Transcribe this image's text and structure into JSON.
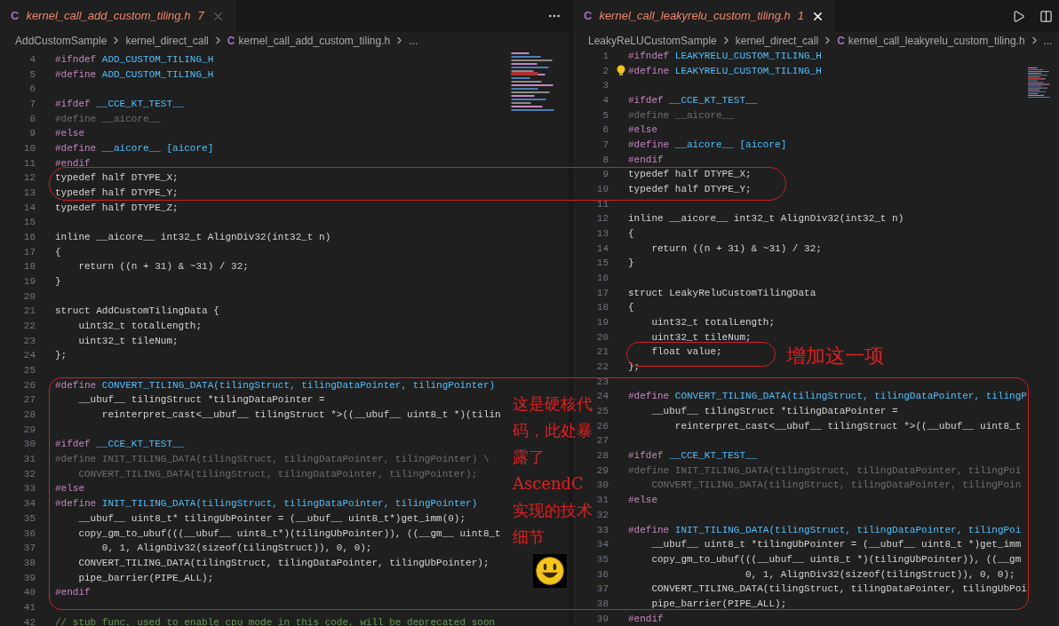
{
  "editors": [
    {
      "tab": {
        "icon": "C",
        "title": "kernel_call_add_custom_tiling.h",
        "problems": "7",
        "focused": false
      },
      "breadcrumbs": [
        {
          "text": "AddCustomSample"
        },
        {
          "text": "kernel_direct_call"
        },
        {
          "text": "kernel_call_add_custom_tiling.h",
          "icon": "C"
        },
        {
          "text": "..."
        }
      ],
      "lines": [
        {
          "n": "4",
          "kind": "directive",
          "text": "#ifndef ADD_CUSTOM_TILING_H"
        },
        {
          "n": "5",
          "kind": "directive",
          "text": "#define ADD_CUSTOM_TILING_H"
        },
        {
          "n": "6",
          "kind": "blank"
        },
        {
          "n": "7",
          "kind": "directive",
          "text": "#ifdef __CCE_KT_TEST__"
        },
        {
          "n": "8",
          "kind": "inactive",
          "text": "#define __aicore__"
        },
        {
          "n": "9",
          "kind": "directive",
          "text": "#else"
        },
        {
          "n": "10",
          "kind": "directive",
          "text": "#define __aicore__ [aicore]"
        },
        {
          "n": "11",
          "kind": "directive",
          "text": "#endif"
        },
        {
          "n": "12",
          "kind": "code",
          "text": "typedef half DTYPE_X;"
        },
        {
          "n": "13",
          "kind": "code",
          "text": "typedef half DTYPE_Y;"
        },
        {
          "n": "14",
          "kind": "code",
          "text": "typedef half DTYPE_Z;"
        },
        {
          "n": "15",
          "kind": "blank"
        },
        {
          "n": "16",
          "kind": "code",
          "text": "inline __aicore__ int32_t AlignDiv32(int32_t n)"
        },
        {
          "n": "17",
          "kind": "code",
          "text": "{"
        },
        {
          "n": "18",
          "kind": "code",
          "text": "    return ((n + 31) & ~31) / 32;"
        },
        {
          "n": "19",
          "kind": "code",
          "text": "}"
        },
        {
          "n": "20",
          "kind": "blank"
        },
        {
          "n": "21",
          "kind": "code",
          "text": "struct AddCustomTilingData {"
        },
        {
          "n": "22",
          "kind": "code",
          "text": "    uint32_t totalLength;"
        },
        {
          "n": "23",
          "kind": "code",
          "text": "    uint32_t tileNum;"
        },
        {
          "n": "24",
          "kind": "code",
          "text": "};"
        },
        {
          "n": "25",
          "kind": "blank"
        },
        {
          "n": "26",
          "kind": "directive",
          "text": "#define CONVERT_TILING_DATA(tilingStruct, tilingDataPointer, tilingPointer)"
        },
        {
          "n": "27",
          "kind": "code",
          "text": "    __ubuf__ tilingStruct *tilingDataPointer ="
        },
        {
          "n": "28",
          "kind": "code",
          "text": "        reinterpret_cast<__ubuf__ tilingStruct *>((__ubuf__ uint8_t *)(tilin"
        },
        {
          "n": "29",
          "kind": "blank"
        },
        {
          "n": "30",
          "kind": "directive",
          "text": "#ifdef __CCE_KT_TEST__"
        },
        {
          "n": "31",
          "kind": "inactive",
          "text": "#define INIT_TILING_DATA(tilingStruct, tilingDataPointer, tilingPointer) \\"
        },
        {
          "n": "32",
          "kind": "inactive",
          "text": "    CONVERT_TILING_DATA(tilingStruct, tilingDataPointer, tilingPointer);"
        },
        {
          "n": "33",
          "kind": "directive",
          "text": "#else"
        },
        {
          "n": "34",
          "kind": "directive",
          "text": "#define INIT_TILING_DATA(tilingStruct, tilingDataPointer, tilingPointer)"
        },
        {
          "n": "35",
          "kind": "code",
          "text": "    __ubuf__ uint8_t* tilingUbPointer = (__ubuf__ uint8_t*)get_imm(0);"
        },
        {
          "n": "36",
          "kind": "code",
          "text": "    copy_gm_to_ubuf(((__ubuf__ uint8_t*)(tilingUbPointer)), ((__gm__ uint8_t"
        },
        {
          "n": "37",
          "kind": "code",
          "text": "        0, 1, AlignDiv32(sizeof(tilingStruct)), 0, 0);"
        },
        {
          "n": "38",
          "kind": "code",
          "text": "    CONVERT_TILING_DATA(tilingStruct, tilingDataPointer, tilingUbPointer);"
        },
        {
          "n": "39",
          "kind": "code",
          "text": "    pipe_barrier(PIPE_ALL);"
        },
        {
          "n": "40",
          "kind": "directive",
          "text": "#endif"
        },
        {
          "n": "41",
          "kind": "blank"
        },
        {
          "n": "42",
          "kind": "comment",
          "text": "// stub func, used to enable cpu mode in this code, will be deprecated soon"
        }
      ]
    },
    {
      "tab": {
        "icon": "C",
        "title": "kernel_call_leakyrelu_custom_tiling.h",
        "problems": "1",
        "focused": true
      },
      "breadcrumbs": [
        {
          "text": "LeakyReLUCustomSample"
        },
        {
          "text": "kernel_direct_call"
        },
        {
          "text": "kernel_call_leakyrelu_custom_tiling.h",
          "icon": "C"
        },
        {
          "text": "..."
        }
      ],
      "lines": [
        {
          "n": "1",
          "kind": "directive",
          "text": "#ifndef LEAKYRELU_CUSTOM_TILING_H"
        },
        {
          "n": "2",
          "kind": "directive",
          "text": "#define LEAKYRELU_CUSTOM_TILING_H"
        },
        {
          "n": "3",
          "kind": "blank"
        },
        {
          "n": "4",
          "kind": "directive",
          "text": "#ifdef __CCE_KT_TEST__"
        },
        {
          "n": "5",
          "kind": "inactive",
          "text": "#define __aicore__"
        },
        {
          "n": "6",
          "kind": "directive",
          "text": "#else"
        },
        {
          "n": "7",
          "kind": "directive",
          "text": "#define __aicore__ [aicore]"
        },
        {
          "n": "8",
          "kind": "directive",
          "text": "#endif"
        },
        {
          "n": "9",
          "kind": "code",
          "text": "typedef half DTYPE_X;"
        },
        {
          "n": "10",
          "kind": "code",
          "text": "typedef half DTYPE_Y;"
        },
        {
          "n": "11",
          "kind": "blank"
        },
        {
          "n": "12",
          "kind": "code",
          "text": "inline __aicore__ int32_t AlignDiv32(int32_t n)"
        },
        {
          "n": "13",
          "kind": "code",
          "text": "{"
        },
        {
          "n": "14",
          "kind": "code",
          "text": "    return ((n + 31) & ~31) / 32;"
        },
        {
          "n": "15",
          "kind": "code",
          "text": "}"
        },
        {
          "n": "16",
          "kind": "blank"
        },
        {
          "n": "17",
          "kind": "code",
          "text": "struct LeakyReluCustomTilingData"
        },
        {
          "n": "18",
          "kind": "code",
          "text": "{"
        },
        {
          "n": "19",
          "kind": "code",
          "text": "    uint32_t totalLength;"
        },
        {
          "n": "20",
          "kind": "code",
          "text": "    uint32_t tileNum;"
        },
        {
          "n": "21",
          "kind": "code",
          "text": "    float value;"
        },
        {
          "n": "22",
          "kind": "code",
          "text": "};"
        },
        {
          "n": "23",
          "kind": "blank"
        },
        {
          "n": "24",
          "kind": "directive",
          "text": "#define CONVERT_TILING_DATA(tilingStruct, tilingDataPointer, tilingP"
        },
        {
          "n": "25",
          "kind": "code",
          "text": "    __ubuf__ tilingStruct *tilingDataPointer ="
        },
        {
          "n": "26",
          "kind": "code",
          "text": "        reinterpret_cast<__ubuf__ tilingStruct *>((__ubuf__ uint8_t"
        },
        {
          "n": "27",
          "kind": "blank"
        },
        {
          "n": "28",
          "kind": "directive",
          "text": "#ifdef __CCE_KT_TEST__"
        },
        {
          "n": "29",
          "kind": "inactive",
          "text": "#define INIT_TILING_DATA(tilingStruct, tilingDataPointer, tilingPoi"
        },
        {
          "n": "30",
          "kind": "inactive",
          "text": "    CONVERT_TILING_DATA(tilingStruct, tilingDataPointer, tilingPoin"
        },
        {
          "n": "31",
          "kind": "directive",
          "text": "#else"
        },
        {
          "n": "32",
          "kind": "blank"
        },
        {
          "n": "33",
          "kind": "directive",
          "text": "#define INIT_TILING_DATA(tilingStruct, tilingDataPointer, tilingPoi"
        },
        {
          "n": "34",
          "kind": "code",
          "text": "    __ubuf__ uint8_t *tilingUbPointer = (__ubuf__ uint8_t *)get_imm"
        },
        {
          "n": "35",
          "kind": "code",
          "text": "    copy_gm_to_ubuf(((__ubuf__ uint8_t *)(tilingUbPointer)), ((__gm"
        },
        {
          "n": "36",
          "kind": "code",
          "text": "                    0, 1, AlignDiv32(sizeof(tilingStruct)), 0, 0);"
        },
        {
          "n": "37",
          "kind": "code",
          "text": "    CONVERT_TILING_DATA(tilingStruct, tilingDataPointer, tilingUbPoi"
        },
        {
          "n": "38",
          "kind": "code",
          "text": "    pipe_barrier(PIPE_ALL);"
        },
        {
          "n": "39",
          "kind": "directive",
          "text": "#endif"
        }
      ]
    }
  ],
  "annotations": [
    {
      "text": "增加这一项"
    },
    {
      "text": "这是硬核代码，此处暴露了AscendC实现的技术细节"
    }
  ]
}
